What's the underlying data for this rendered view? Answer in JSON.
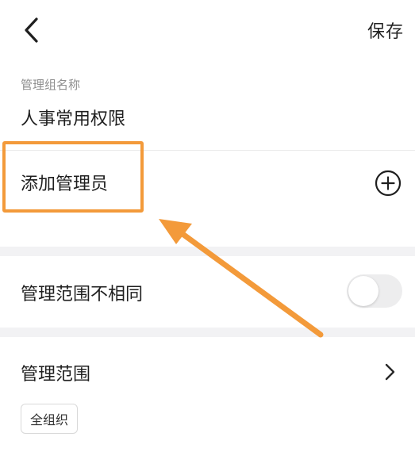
{
  "nav": {
    "back_icon": "chevron-left-icon",
    "save_label": "保存"
  },
  "group_name": {
    "label": "管理组名称",
    "value": "人事常用权限"
  },
  "add_admin": {
    "label": "添加管理员",
    "icon": "plus-circle-icon"
  },
  "toggle_row": {
    "label": "管理范围不相同",
    "enabled": false
  },
  "scope_row": {
    "label": "管理范围",
    "icon": "chevron-right-icon",
    "tag": "全组织"
  },
  "colors": {
    "annotation": "#f39a3a",
    "section_gap": "#f2f2f4",
    "toggle_off": "#ededee"
  }
}
